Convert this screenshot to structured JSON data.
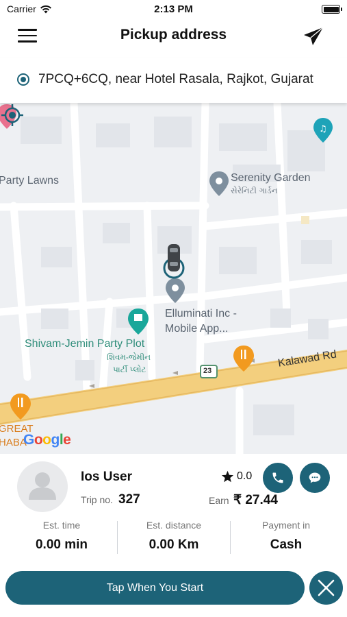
{
  "status_bar": {
    "carrier": "Carrier",
    "time": "2:13 PM",
    "wifi_icon": "wifi-icon",
    "battery_icon": "battery-full-icon"
  },
  "header": {
    "title": "Pickup address",
    "menu_icon": "hamburger-menu-icon",
    "send_icon": "paper-plane-icon"
  },
  "pickup": {
    "address": "7PCQ+6CQ, near Hotel Rasala, Rajkot, Gujarat"
  },
  "map": {
    "labels": {
      "party_lawns": "Party Lawns",
      "serenity_garden": "Serenity Garden",
      "serenity_garden_gujarati": "સેરેનિટી ગાર્ડન",
      "elluminati_line1": "Elluminati Inc -",
      "elluminati_line2": "Mobile App...",
      "shivam_jemin": "Shivam-Jemin Party Plot",
      "shivam_gujarati_line1": "શિવમ-જેમીન",
      "shivam_gujarati_line2": "પાર્ટી પ્લોટ",
      "kalawad_rd": "Kalawad Rd",
      "route_number": "23",
      "great": "GREAT",
      "dhaba": "HABA",
      "google": "Google"
    },
    "colors": {
      "road": "#f3cf7e",
      "accent": "#1d6378"
    }
  },
  "driver": {
    "name": "Ios User",
    "trip_label": "Trip no.",
    "trip_no": "327",
    "rating": "0.0",
    "earn_label": "Earn",
    "earn_value": "₹ 27.44"
  },
  "stats": [
    {
      "label": "Est. time",
      "value": "0.00 min"
    },
    {
      "label": "Est. distance",
      "value": "0.00  Km"
    },
    {
      "label": "Payment in",
      "value": "Cash"
    }
  ],
  "actions": {
    "start_label": "Tap When You Start",
    "accent": "#1d6378"
  }
}
